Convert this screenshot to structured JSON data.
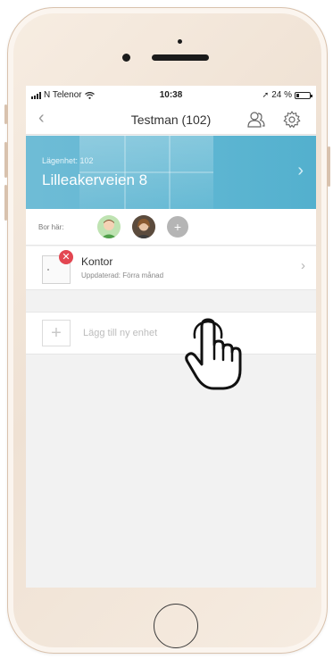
{
  "status_bar": {
    "carrier": "N Telenor",
    "time": "10:38",
    "battery": "24 %",
    "battery_level": 0.24
  },
  "nav": {
    "title": "Testman (102)",
    "icons": [
      "back-chevron-icon",
      "user-icon",
      "gear-icon"
    ]
  },
  "banner": {
    "subtitle": "Lägenhet: 102",
    "title": "Lilleakerveien 8"
  },
  "residents": {
    "label": "Bor här:",
    "add_symbol": "+"
  },
  "device": {
    "name": "Kontor",
    "updated": "Uppdaterad: Förra månad",
    "error_symbol": "✕",
    "error_color": "#e34651"
  },
  "add_unit": {
    "symbol": "+",
    "label": "Lägg till ny enhet"
  },
  "colors": {
    "banner": "#5eb6d2",
    "background": "#f2f2f2"
  }
}
